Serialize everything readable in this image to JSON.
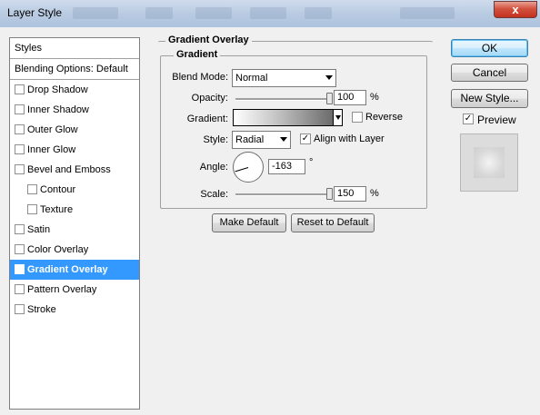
{
  "window": {
    "title": "Layer Style",
    "close_glyph": "x"
  },
  "styles_panel": {
    "header": "Styles",
    "blending_options": "Blending Options: Default",
    "items": [
      {
        "label": "Drop Shadow",
        "checked": false,
        "indent": false,
        "selected": false
      },
      {
        "label": "Inner Shadow",
        "checked": false,
        "indent": false,
        "selected": false
      },
      {
        "label": "Outer Glow",
        "checked": false,
        "indent": false,
        "selected": false
      },
      {
        "label": "Inner Glow",
        "checked": false,
        "indent": false,
        "selected": false
      },
      {
        "label": "Bevel and Emboss",
        "checked": false,
        "indent": false,
        "selected": false
      },
      {
        "label": "Contour",
        "checked": false,
        "indent": true,
        "selected": false
      },
      {
        "label": "Texture",
        "checked": false,
        "indent": true,
        "selected": false
      },
      {
        "label": "Satin",
        "checked": false,
        "indent": false,
        "selected": false
      },
      {
        "label": "Color Overlay",
        "checked": false,
        "indent": false,
        "selected": false
      },
      {
        "label": "Gradient Overlay",
        "checked": true,
        "indent": false,
        "selected": true
      },
      {
        "label": "Pattern Overlay",
        "checked": false,
        "indent": false,
        "selected": false
      },
      {
        "label": "Stroke",
        "checked": false,
        "indent": false,
        "selected": false
      }
    ]
  },
  "gradient_overlay": {
    "title": "Gradient Overlay",
    "group_title": "Gradient",
    "blend_mode_label": "Blend Mode:",
    "blend_mode_value": "Normal",
    "opacity_label": "Opacity:",
    "opacity_value": "100",
    "opacity_unit": "%",
    "opacity_fraction": 1.0,
    "gradient_label": "Gradient:",
    "reverse_label": "Reverse",
    "reverse_checked": false,
    "style_label": "Style:",
    "style_value": "Radial",
    "align_label": "Align with Layer",
    "align_checked": true,
    "angle_label": "Angle:",
    "angle_value": "-163",
    "angle_unit": "°",
    "scale_label": "Scale:",
    "scale_value": "150",
    "scale_unit": "%",
    "scale_fraction": 1.0,
    "make_default": "Make Default",
    "reset_default": "Reset to Default"
  },
  "actions": {
    "ok": "OK",
    "cancel": "Cancel",
    "new_style": "New Style...",
    "preview_label": "Preview",
    "preview_checked": true
  },
  "colors": {
    "selection": "#3399ff",
    "titlebar": "#b9cbe2",
    "close": "#c3311f"
  }
}
